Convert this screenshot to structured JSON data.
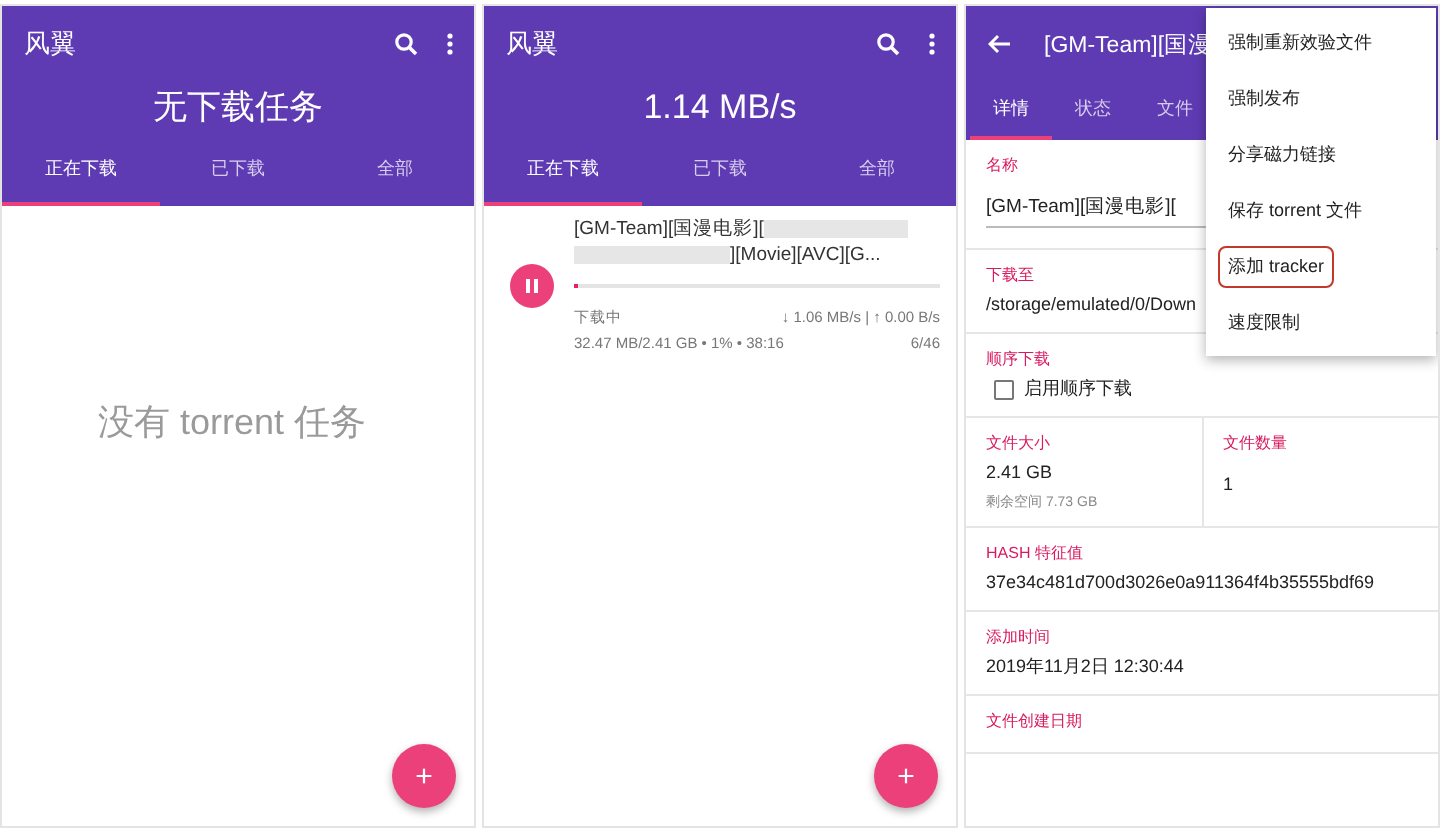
{
  "screens": [
    {
      "kind": "list",
      "app_title": "风翼",
      "headline": "无下载任务",
      "tabs": [
        {
          "label": "正在下载",
          "selected": true
        },
        {
          "label": "已下载",
          "selected": false
        },
        {
          "label": "全部",
          "selected": false
        }
      ],
      "empty_message": "没有 torrent 任务"
    },
    {
      "kind": "list",
      "app_title": "风翼",
      "headline": "1.14 MB/s",
      "tabs": [
        {
          "label": "正在下载",
          "selected": true
        },
        {
          "label": "已下载",
          "selected": false
        },
        {
          "label": "全部",
          "selected": false
        }
      ],
      "torrents": [
        {
          "name_start": "[GM-Team][国漫电影][",
          "name_end": "][Movie][AVC][G...",
          "status": "下载中",
          "speeds": "↓ 1.06 MB/s | ↑ 0.00 B/s",
          "progress_text": "32.47 MB/2.41 GB • 1% • 38:16",
          "pieces": "6/46",
          "level": 0.013
        }
      ]
    },
    {
      "kind": "detail",
      "title": "[GM-Team][国漫",
      "tabs": [
        {
          "label": "详情",
          "selected": true
        },
        {
          "label": "状态",
          "selected": false
        },
        {
          "label": "文件",
          "selected": false
        }
      ],
      "fields": [
        {
          "kind": "input",
          "label": "名称",
          "value": "[GM-Team][国漫电影]["
        },
        {
          "kind": "text",
          "label": "下载至",
          "value": "/storage/emulated/0/Down"
        },
        {
          "kind": "checkbox",
          "label": "顺序下载",
          "option": "启用顺序下载",
          "checked": false
        },
        {
          "kind": "pair",
          "label": "文件大小",
          "value": "2.41 GB",
          "note": "剩余空间 7.73 GB",
          "label2": "文件数量",
          "value2": "1"
        },
        {
          "kind": "text",
          "label": "HASH 特征值",
          "value": "37e34c481d700d3026e0a911364f4b35555bdf69"
        },
        {
          "kind": "text",
          "label": "添加时间",
          "value": "2019年11月2日 12:30:44"
        },
        {
          "kind": "text",
          "label": "文件创建日期"
        }
      ],
      "menu": [
        {
          "label": "强制重新效验文件",
          "highlighted": false
        },
        {
          "label": "强制发布",
          "highlighted": false
        },
        {
          "label": "分享磁力链接",
          "highlighted": false
        },
        {
          "label": "保存 torrent 文件",
          "highlighted": false
        },
        {
          "label": "添加 tracker",
          "highlighted": true
        },
        {
          "label": "速度限制",
          "highlighted": false
        }
      ]
    }
  ],
  "fab": "+"
}
